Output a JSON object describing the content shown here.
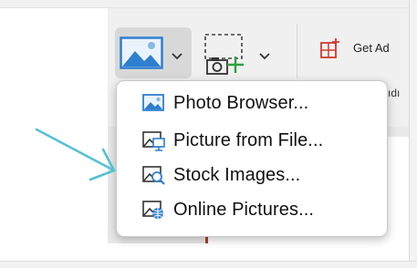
{
  "ribbon": {
    "pictures_button": {
      "icon": "picture-icon",
      "dropdown_icon": "chevron-down-icon"
    },
    "screenshot_button": {
      "icon": "screenshot-camera-icon",
      "dropdown_icon": "chevron-down-icon"
    },
    "addins_button": {
      "icon": "add-ins-icon",
      "label": "Get Ad"
    },
    "cut_text": "ıdı"
  },
  "menu": {
    "items": [
      {
        "label": "Photo Browser...",
        "icon": "photo-browser-icon"
      },
      {
        "label": "Picture from File...",
        "icon": "picture-from-file-icon"
      },
      {
        "label": "Stock Images...",
        "icon": "stock-images-icon"
      },
      {
        "label": "Online Pictures...",
        "icon": "online-pictures-icon"
      }
    ]
  },
  "colors": {
    "accent_blue": "#2f7fd0",
    "annotation_arrow": "#57c1d3",
    "add_green": "#2ea043",
    "addins_red": "#d13b2f",
    "doc_border": "#b2402a"
  }
}
